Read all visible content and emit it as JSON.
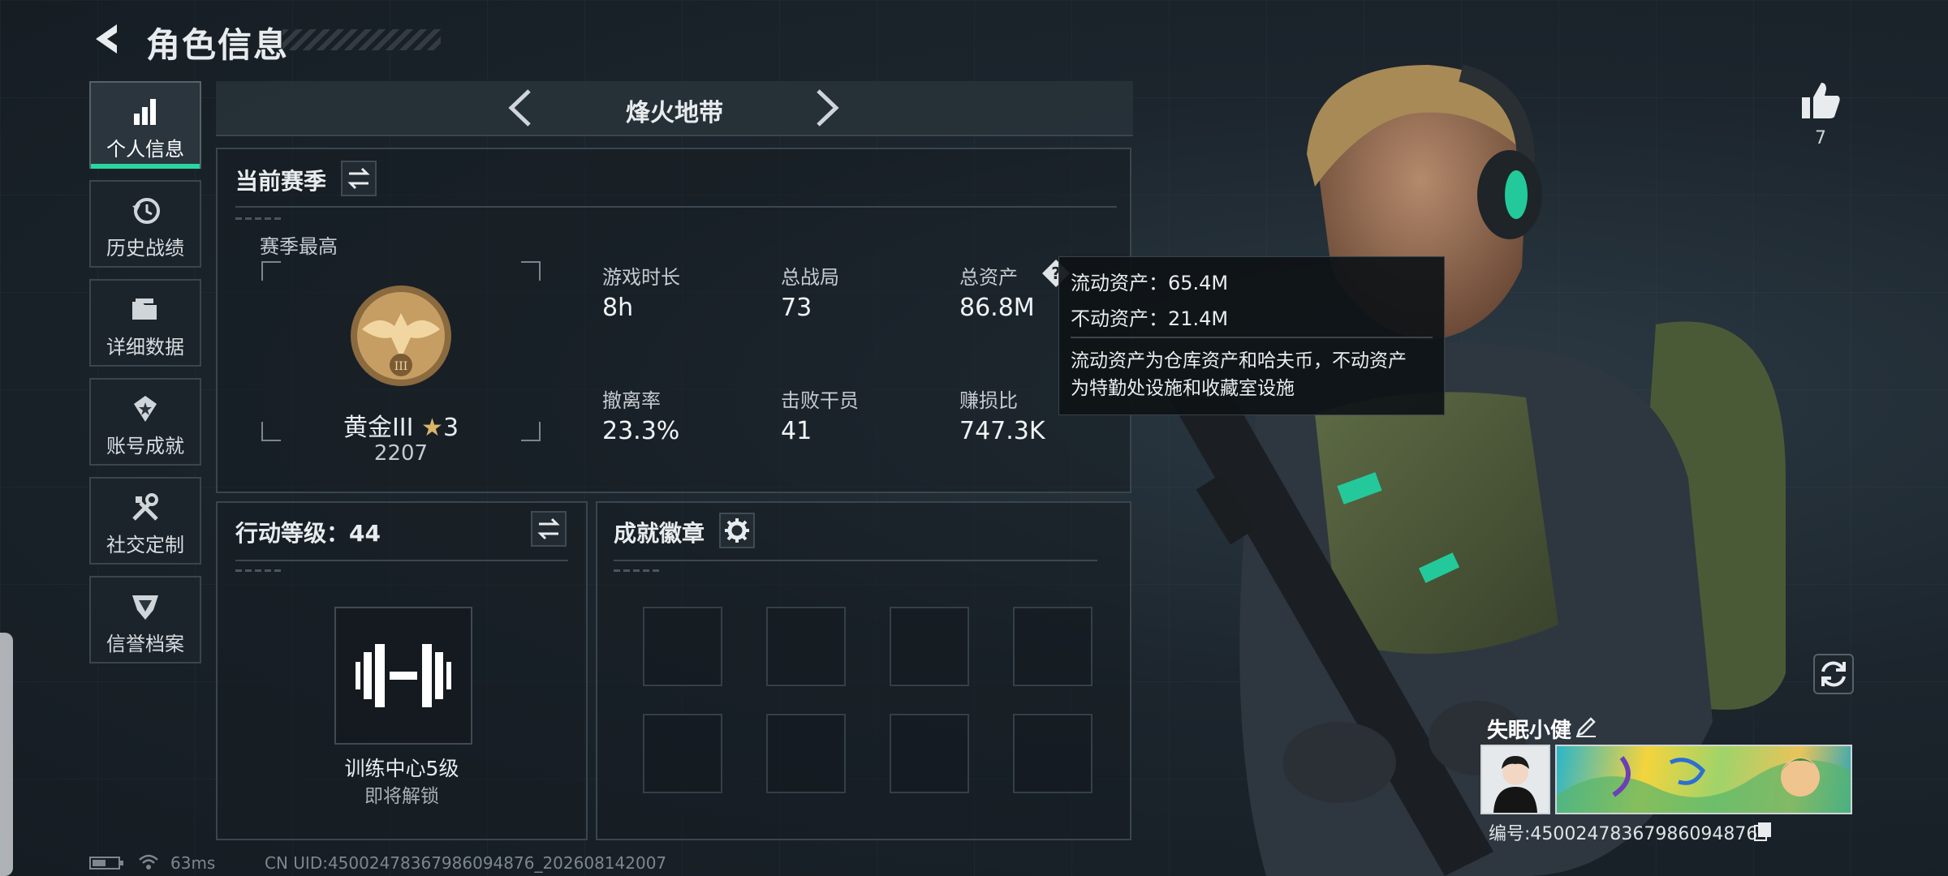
{
  "header": {
    "title": "角色信息"
  },
  "side_nav": [
    {
      "label": "个人信息",
      "icon": "bar-chart-icon",
      "active": true
    },
    {
      "label": "历史战绩",
      "icon": "history-clock-icon",
      "active": false
    },
    {
      "label": "详细数据",
      "icon": "folder-icon",
      "active": false
    },
    {
      "label": "账号成就",
      "icon": "achievement-icon",
      "active": false
    },
    {
      "label": "社交定制",
      "icon": "tools-icon",
      "active": false
    },
    {
      "label": "信誉档案",
      "icon": "credit-shield-icon",
      "active": false
    }
  ],
  "mode_tab": {
    "title": "烽火地带"
  },
  "season": {
    "title": "当前赛季",
    "best_label": "赛季最高",
    "rank_name": "黄金III",
    "rank_stars": "3",
    "rank_score": "2207",
    "stats": [
      {
        "label": "游戏时长",
        "value": "8h"
      },
      {
        "label": "总战局",
        "value": "73"
      },
      {
        "label": "总资产",
        "value": "86.8M"
      },
      {
        "label": "撤离率",
        "value": "23.3%"
      },
      {
        "label": "击败干员",
        "value": "41"
      },
      {
        "label": "赚损比",
        "value": "747.3K"
      }
    ]
  },
  "tooltip": {
    "liquid": "流动资产：65.4M",
    "fixed": "不动资产：21.4M",
    "desc_line1": "流动资产为仓库资产和哈夫币，不动资产",
    "desc_line2": "为特勤处设施和收藏室设施"
  },
  "action_level": {
    "title": "行动等级：44",
    "item_name": "训练中心5级",
    "item_status": "即将解锁"
  },
  "badges": {
    "title": "成就徽章"
  },
  "profile": {
    "likes": "7",
    "player_name": "失眠小健",
    "player_id": "编号:450024783679860948​76"
  },
  "status_bar": {
    "ping": "63ms",
    "uid": "CN UID:450024783679860948​76_202608142007"
  },
  "colors": {
    "accent": "#29d6a0",
    "panel_border": "#3a454d",
    "background": "#1c252d"
  }
}
